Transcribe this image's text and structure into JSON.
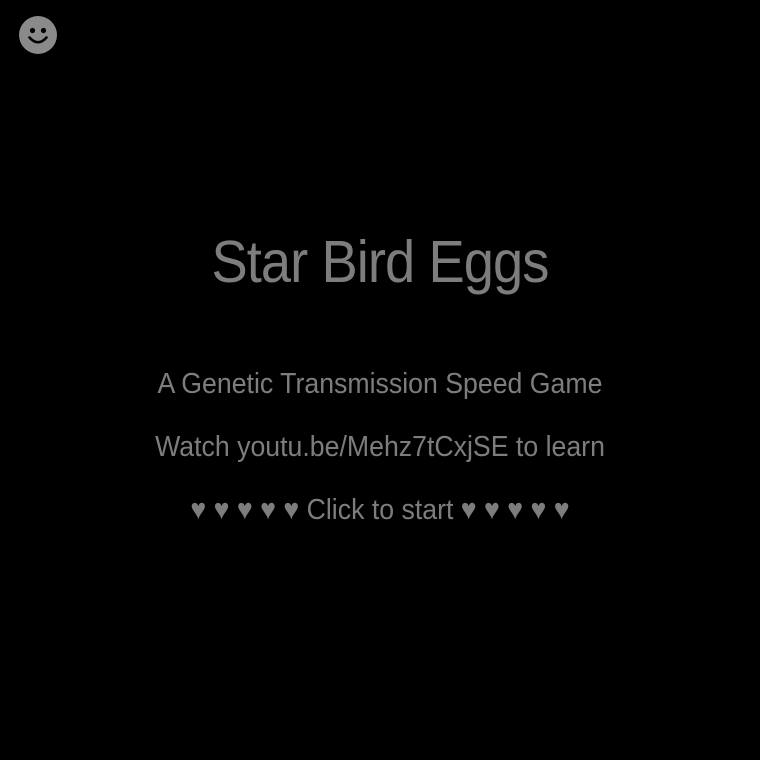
{
  "game": {
    "title": "Star Bird Eggs",
    "subtitle": "A Genetic Transmission Speed Game",
    "learn_text": "Watch youtu.be/Mehz7tCxjSE to learn",
    "start_text": "♥ ♥ ♥ ♥ ♥ Click to start ♥ ♥ ♥ ♥ ♥"
  },
  "icons": {
    "corner": "smiley-face-icon"
  },
  "colors": {
    "background": "#000000",
    "text": "#7d7d7d",
    "icon": "#8a8a8a"
  }
}
